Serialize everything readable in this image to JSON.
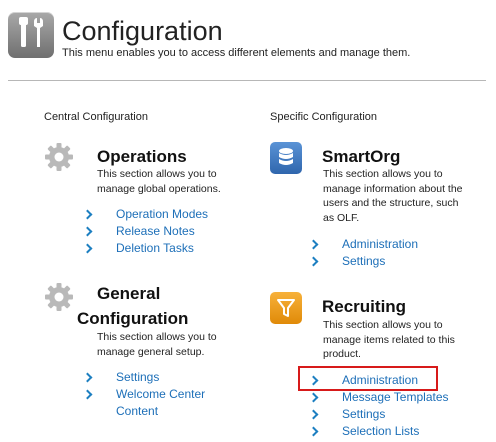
{
  "header": {
    "title": "Configuration",
    "description": "This menu enables you to access different elements and manage them."
  },
  "columns": {
    "central": "Central Configuration",
    "specific": "Specific Configuration"
  },
  "operations": {
    "title": "Operations",
    "description": "This section allows you to manage global operations.",
    "links": [
      "Operation Modes",
      "Release Notes",
      "Deletion Tasks"
    ]
  },
  "general": {
    "title_line1": "General",
    "title_line2": "Configuration",
    "description": "This section allows you to manage general setup.",
    "links": [
      "Settings",
      "Welcome Center",
      "Content"
    ]
  },
  "smartorg": {
    "title": "SmartOrg",
    "description": "This section allows you to manage information about the users and the structure, such as OLF.",
    "links": [
      "Administration",
      "Settings"
    ]
  },
  "recruiting": {
    "title": "Recruiting",
    "description": "This section allows you to manage items related to this product.",
    "links": [
      "Administration",
      "Message Templates",
      "Settings",
      "Selection Lists"
    ]
  },
  "colors": {
    "link": "#1d6fb8",
    "chevron": "#1d7fc1",
    "highlight": "#d71a1a",
    "smartorg_icon": "#2f66ad",
    "recruiting_icon": "#e08a08"
  },
  "icons": {
    "header": "tools-icon",
    "operations": "gear-icon",
    "general": "gear-icon",
    "smartorg": "database-icon",
    "recruiting": "funnel-icon"
  }
}
